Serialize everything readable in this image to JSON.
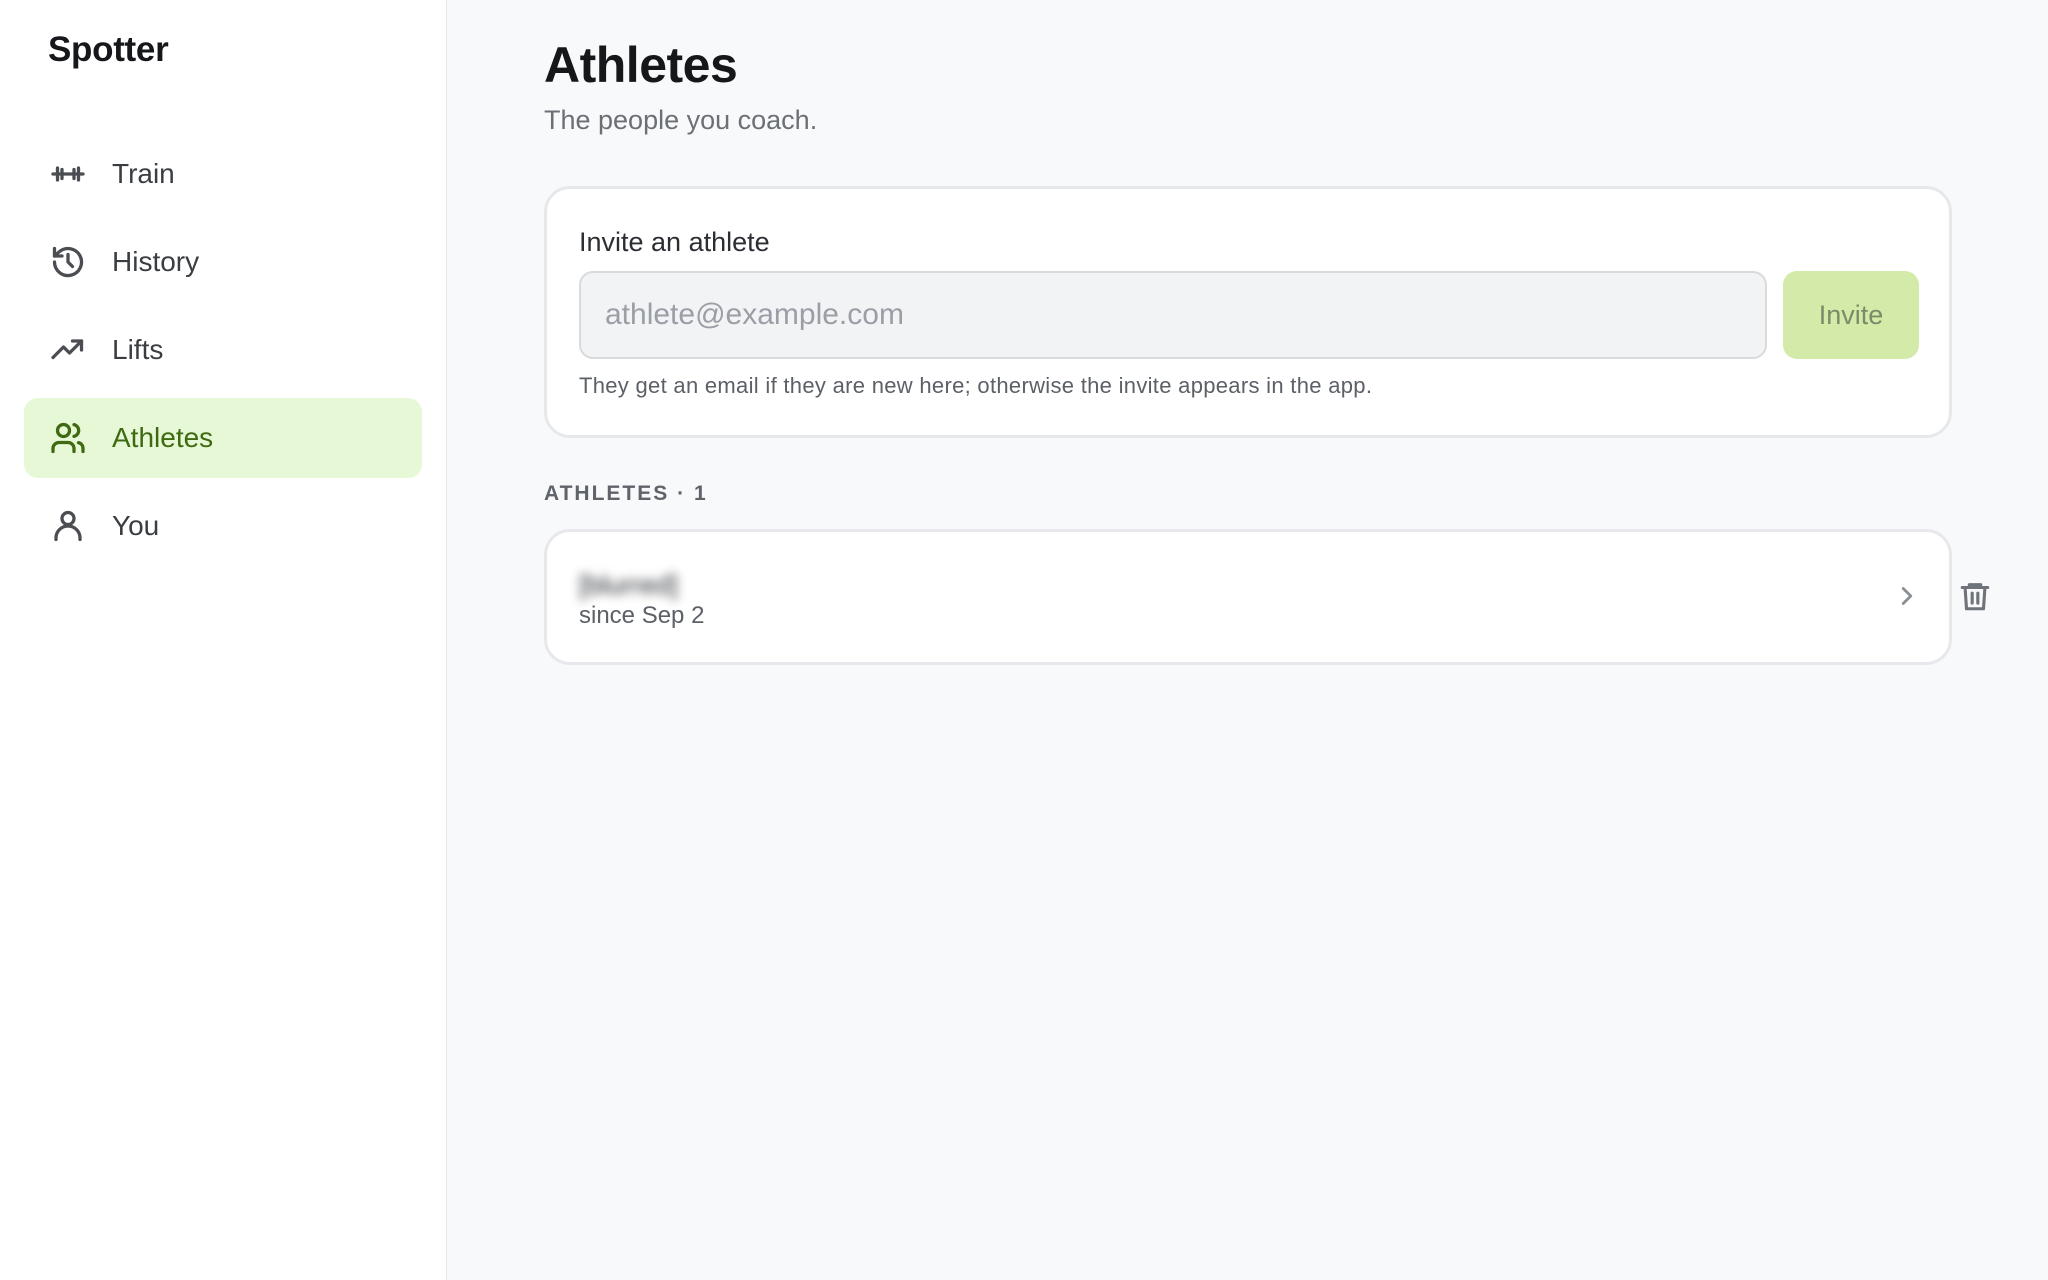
{
  "app": {
    "name": "Spotter"
  },
  "sidebar": {
    "items": [
      {
        "label": "Train",
        "icon": "dumbbell-icon",
        "active": false
      },
      {
        "label": "History",
        "icon": "history-icon",
        "active": false
      },
      {
        "label": "Lifts",
        "icon": "trending-up-icon",
        "active": false
      },
      {
        "label": "Athletes",
        "icon": "users-icon",
        "active": true
      },
      {
        "label": "You",
        "icon": "user-icon",
        "active": false
      }
    ]
  },
  "page": {
    "title": "Athletes",
    "subtitle": "The people you coach."
  },
  "invite": {
    "title": "Invite an athlete",
    "placeholder": "athlete@example.com",
    "value": "",
    "button_label": "Invite",
    "help_text": "They get an email if they are new here; otherwise the invite appears in the app."
  },
  "athletes": {
    "section_label": "ATHLETES · 1",
    "items": [
      {
        "email": "[blurred]",
        "since": "since Sep 2"
      }
    ]
  },
  "colors": {
    "accent_bg": "#e6f8d6",
    "accent_text": "#3f6a12",
    "invite_button_bg": "#d3eaa8"
  }
}
